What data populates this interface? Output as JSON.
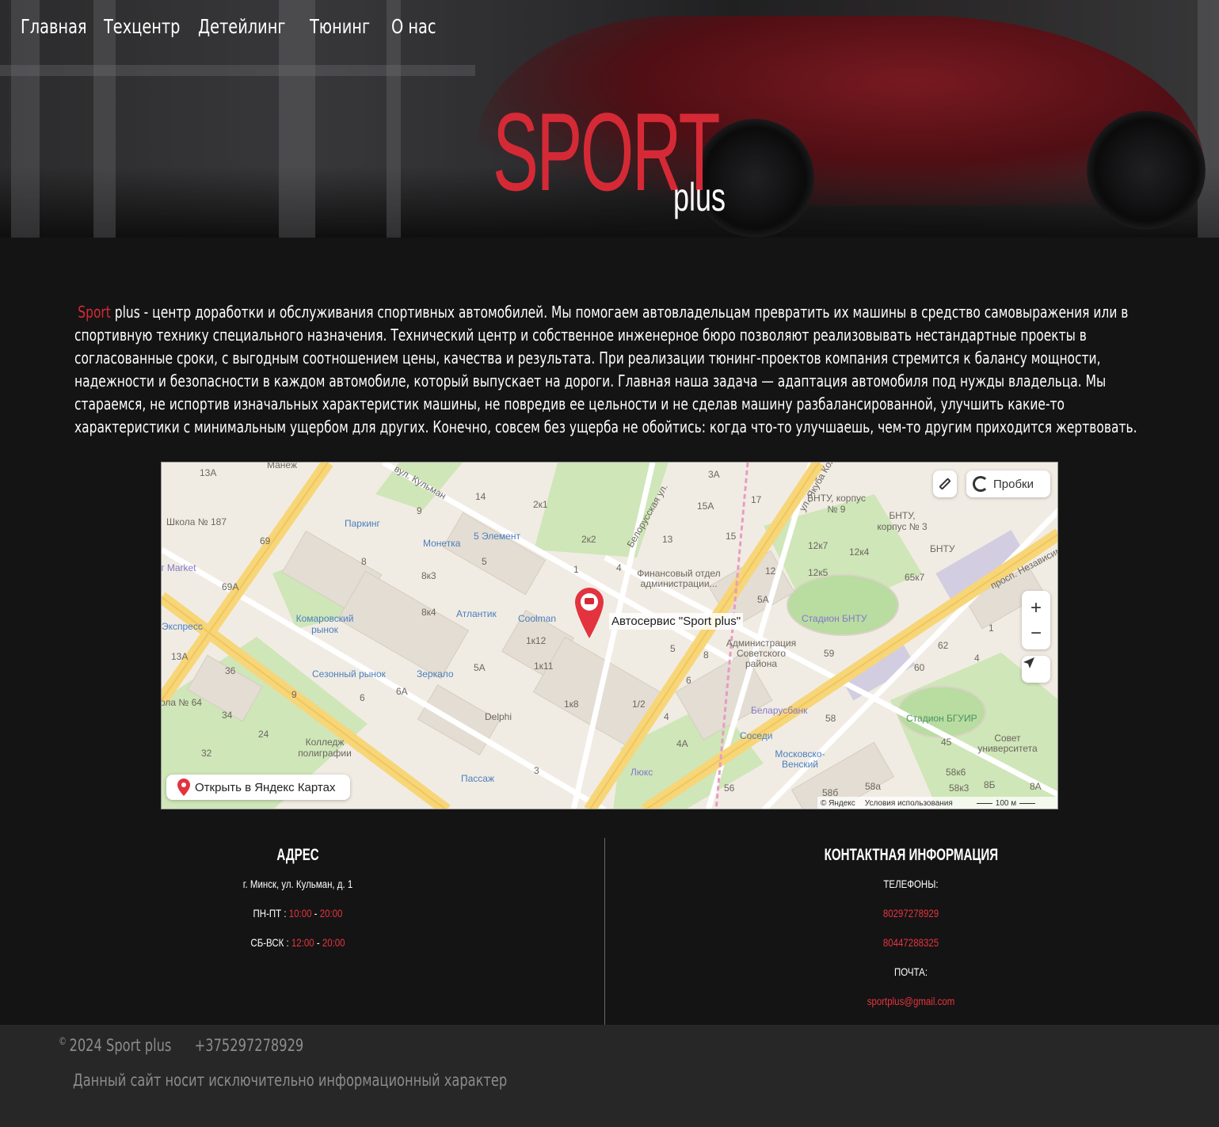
{
  "nav": {
    "items": [
      "Главная",
      "Техцентр",
      "Детейлинг",
      "Тюнинг",
      "О нас"
    ]
  },
  "logo": {
    "main": "SPORT",
    "sub": "plus"
  },
  "intro": {
    "brand": "Sport",
    "text": "plus - центр доработки и обслуживания спортивных автомобилей. Мы помогаем автовладельцам превратить их машины в средство самовыражения или в спортивную технику специального назначения. Технический центр и собственное инженерное бюро позволяют реализовывать нестандартные проекты в согласованные сроки, с выгодным соотношением цены, качества и результата. При реализации тюнинг-проектов компания стремится к балансу мощности, надежности и безопасности в каждом автомобиле, который выпускает на дороги. Главная наша задача — адаптация автомобиля под нужды владельца. Мы стараемся, не испортив изначальных характеристик машины, не повредив ее цельности и не сделав машину разбалансированной, улучшить какие-то характеристики с минимальным ущербом для других. Конечно, совсем без ущерба не обойтись: когда что-то улучшаешь, чем-то другим приходится жертвовать."
  },
  "map": {
    "pin_label": "Автосервис \"Sport plus\"",
    "traffic_button": "Пробки",
    "open_button": "Открыть в Яндекс Картах",
    "copyright": "© Яндекс",
    "terms": "Условия использования",
    "scale": "100 м",
    "zoom_in": "+",
    "zoom_out": "−",
    "labels": [
      "Школа № 187",
      "13А",
      "Манеж",
      "вул. Кульман",
      "14",
      "Паркинг",
      "9",
      "Монетка",
      "5 Элемент",
      "2к1",
      "2к2",
      "Белорусская ул.",
      "13",
      "15А",
      "17",
      "3А",
      "ул. Якуба Коласа",
      "БНТУ, корпус № 9",
      "БНТУ, корпус № 3",
      "БНТУ",
      "69",
      "8",
      "8к3",
      "5",
      "1",
      "4",
      "Финансовый отдел администрации...",
      "15",
      "12к7",
      "12к4",
      "65к7",
      "просп. Независимости",
      "т Market",
      "69А",
      "Комаровский рынок",
      "Атлантик",
      "Coolman",
      "8к4",
      "12",
      "12к5",
      "5А",
      "Стадион БНТУ",
      "Экспресс",
      "13А",
      "36",
      "Сезонный рынок",
      "Зеркало",
      "1к12",
      "1к11",
      "5А",
      "5",
      "8",
      "Администрация Советского района",
      "59",
      "62",
      "1",
      "4",
      "ола № 64",
      "9",
      "6",
      "6А",
      "Delphi",
      "1к8",
      "1/2",
      "4",
      "6",
      "60",
      "Беларусбанк",
      "Стадион БГУИР",
      "34",
      "24",
      "Колледж полиграфии",
      "32",
      "3",
      "4А",
      "Соседи",
      "58",
      "Московско-Венский",
      "45",
      "Совет университета",
      "Пассаж",
      "Люкс",
      "56",
      "58а",
      "58к6",
      "8Б",
      "8А",
      "58б",
      "58к3"
    ]
  },
  "address": {
    "heading": "АДРЕС",
    "street": "г. Минск, ул. Кульман, д. 1",
    "weekdays_label": "ПН-ПТ :",
    "weekdays_open": "10:00",
    "weekdays_sep": "-",
    "weekdays_close": "20:00",
    "weekend_label": "СБ-ВСК :",
    "weekend_open": "12:00",
    "weekend_sep": "-",
    "weekend_close": "20:00"
  },
  "contacts": {
    "heading": "КОНТАКТНАЯ ИНФОРМАЦИЯ",
    "phones_label": "ТЕЛЕФОНЫ:",
    "phone1": "80297278929",
    "phone2": "80447288325",
    "email_label": "ПОЧТА:",
    "email": "sportplus@gmail.com"
  },
  "footer": {
    "copyright_sign": "©",
    "copyright": "2024 Sport plus",
    "phone": "+375297278929",
    "note": "Данный сайт носит исключительно информационный характер"
  },
  "colors": {
    "accent": "#d52a36",
    "background": "#141414",
    "footer": "#272727"
  }
}
